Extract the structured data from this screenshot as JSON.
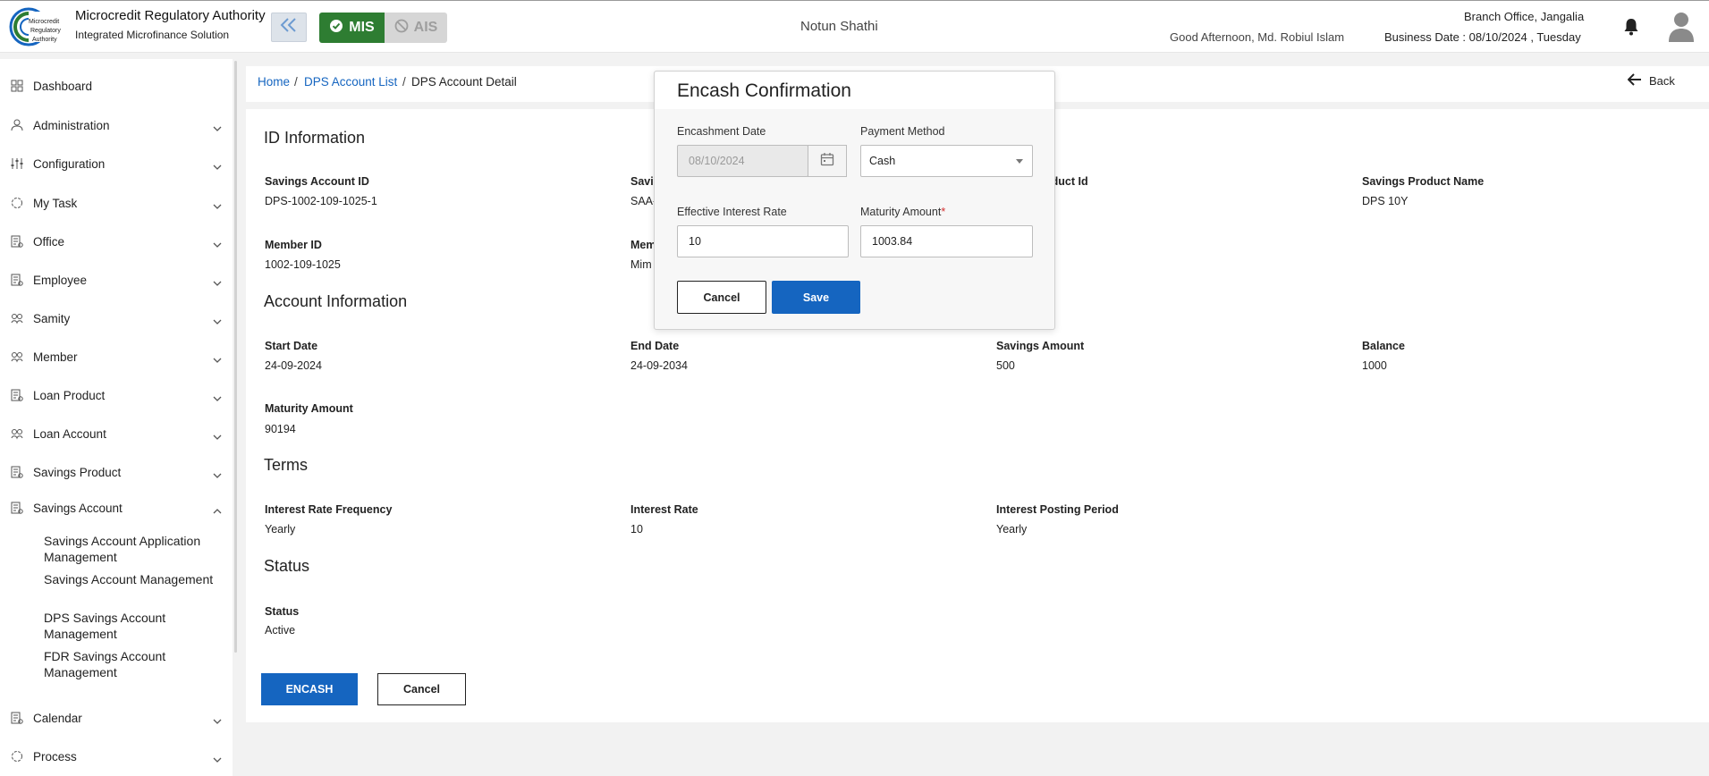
{
  "header": {
    "brand_title": "Microcredit Regulatory Authority",
    "brand_subtitle": "Integrated Microfinance Solution",
    "logo_text": "Microcredit Regulatory Authority",
    "mis_label": "MIS",
    "ais_label": "AIS",
    "org_name": "Notun Shathi",
    "greeting": "Good Afternoon, Md. Robiul Islam",
    "branch": "Branch Office, Jangalia",
    "business_date": "Business Date : 08/10/2024 , Tuesday",
    "accent_green": "#2e7d32",
    "accent_blue": "#1565c0"
  },
  "sidebar": {
    "items": [
      {
        "label": "Dashboard",
        "icon": "dashboard-icon"
      },
      {
        "label": "Administration",
        "icon": "admin-icon"
      },
      {
        "label": "Configuration",
        "icon": "sliders-icon"
      },
      {
        "label": "My Task",
        "icon": "task-icon"
      },
      {
        "label": "Office",
        "icon": "office-icon"
      },
      {
        "label": "Employee",
        "icon": "employee-icon"
      },
      {
        "label": "Samity",
        "icon": "samity-icon"
      },
      {
        "label": "Member",
        "icon": "member-icon"
      },
      {
        "label": "Loan Product",
        "icon": "loan-product-icon"
      },
      {
        "label": "Loan Account",
        "icon": "loan-account-icon"
      },
      {
        "label": "Savings Product",
        "icon": "savings-product-icon"
      },
      {
        "label": "Savings Account",
        "icon": "savings-account-icon"
      },
      {
        "label": "Calendar",
        "icon": "calendar-icon"
      },
      {
        "label": "Process",
        "icon": "process-icon"
      }
    ],
    "savings_account_sub": [
      "Savings Account Application Management",
      "Savings Account Management",
      "DPS Savings Account Management",
      "FDR Savings Account Management"
    ]
  },
  "breadcrumb": {
    "home": "Home",
    "list": "DPS Account List",
    "current": "DPS Account Detail",
    "sep": "/",
    "back": "Back"
  },
  "detail": {
    "id_title": "ID Information",
    "savings_account_id_label": "Savings Account ID",
    "savings_account_id": "DPS-1002-109-1025-1",
    "col2_label_partial": "Savi",
    "col2_value_partial": "SAA-",
    "col3_label_partial": "oduct Id",
    "savings_product_name_label": "Savings Product Name",
    "savings_product_name": "DPS 10Y",
    "member_id_label": "Member ID",
    "member_id": "1002-109-1025",
    "member_label_partial": "Mem",
    "member_value_partial": "Mim",
    "account_title": "Account Information",
    "start_date_label": "Start Date",
    "start_date": "24-09-2024",
    "end_date_label": "End Date",
    "end_date": "24-09-2034",
    "savings_amount_label": "Savings Amount",
    "savings_amount": "500",
    "balance_label": "Balance",
    "balance": "1000",
    "maturity_amount_label": "Maturity Amount",
    "maturity_amount": "90194",
    "terms_title": "Terms",
    "irf_label": "Interest Rate Frequency",
    "irf": "Yearly",
    "ir_label": "Interest Rate",
    "ir": "10",
    "ipp_label": "Interest Posting Period",
    "ipp": "Yearly",
    "status_title": "Status",
    "status_label": "Status",
    "status": "Active"
  },
  "actions": {
    "encash": "ENCASH",
    "cancel": "Cancel"
  },
  "modal": {
    "title": "Encash Confirmation",
    "encashment_date_label": "Encashment Date",
    "encashment_date": "08/10/2024",
    "payment_method_label": "Payment Method",
    "payment_method": "Cash",
    "eir_label": "Effective Interest Rate",
    "eir": "10",
    "maturity_amount_label": "Maturity Amount",
    "required_mark": "*",
    "maturity_amount": "1003.84",
    "cancel": "Cancel",
    "save": "Save"
  }
}
